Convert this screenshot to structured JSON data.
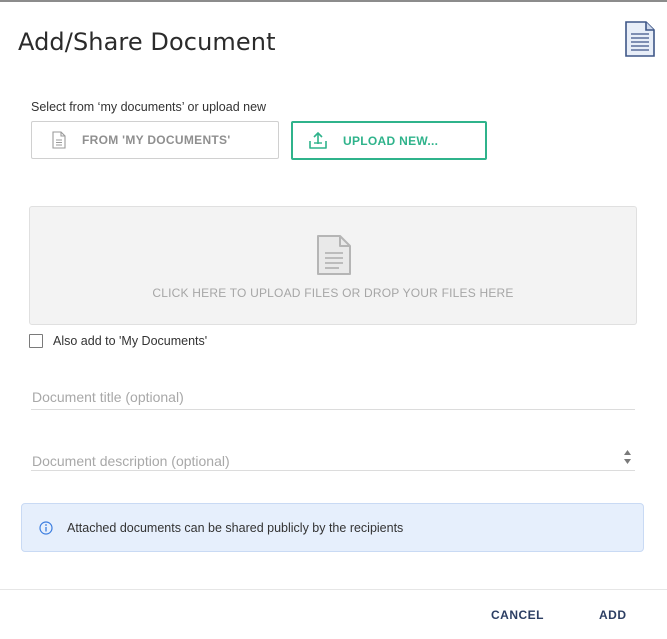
{
  "dialog": {
    "title": "Add/Share Document",
    "header_icon": "document-icon"
  },
  "source": {
    "label": "Select from ‘my documents’ or upload new",
    "my_documents_button": "FROM 'MY DOCUMENTS'",
    "upload_button": "UPLOAD NEW...",
    "my_documents_icon": "file-icon",
    "upload_icon": "upload-tray-icon"
  },
  "dropzone": {
    "text": "CLICK HERE TO UPLOAD FILES OR DROP YOUR FILES HERE",
    "icon": "file-icon"
  },
  "options": {
    "add_to_my_documents_label": "Also add to 'My Documents'",
    "add_to_my_documents_checked": false
  },
  "fields": {
    "title_placeholder": "Document title (optional)",
    "title_value": "",
    "description_placeholder": "Document description (optional)",
    "description_value": ""
  },
  "info": {
    "icon": "info-circle-icon",
    "text": "Attached documents can be shared publicly by the recipients"
  },
  "footer": {
    "cancel_label": "CANCEL",
    "add_label": "ADD"
  },
  "colors": {
    "accent_green": "#2fb38b",
    "footer_button": "#2c3e63",
    "info_background": "#e6effc"
  }
}
